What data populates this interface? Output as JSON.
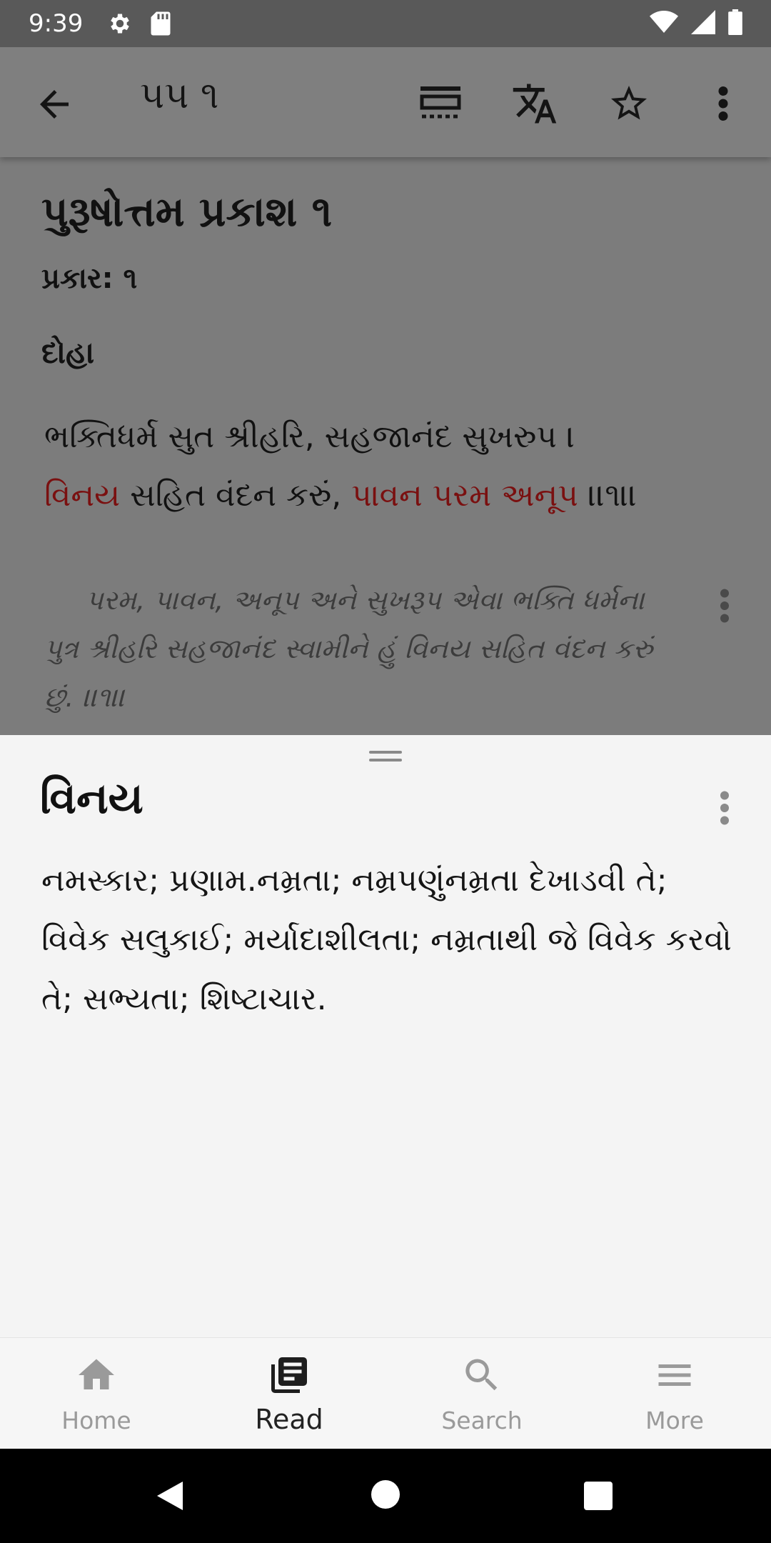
{
  "status_bar": {
    "time": "9:39",
    "icons": [
      "settings-icon",
      "sd-card-icon",
      "wifi-icon",
      "signal-icon",
      "battery-icon"
    ]
  },
  "app_bar": {
    "title": "૫૫ ૧",
    "actions": [
      "back-arrow-icon",
      "reading-mode-icon",
      "translate-icon",
      "star-icon",
      "more-vert-icon"
    ]
  },
  "content": {
    "heading": "પુરૂષોત્તમ પ્રકાશ ૧",
    "subheading": "પ્રકાર: ૧",
    "section": "દોહા",
    "verse_line1": "ભક્તિધર્મ સુત શ્રીહરિ, સહજાનંદ સુખરુપ ।",
    "verse_line2": {
      "hl1": "વિનય",
      "mid": " સહિત વંદન કરું, ",
      "hl2": "પાવન પરમ અનૂપ",
      "end": " ।।૧।।"
    },
    "meaning": "પરમ, પાવન, અનૂપ અને સુખરૂપ એવા ભક્તિ ધર્મના પુત્ર શ્રીહરિ સહજાનંદ સ્વામીને હું વિનય સહિત વંદન કરું છું. ।।૧।।"
  },
  "sheet": {
    "word": "વિનય",
    "definition": "નમસ્કાર; પ્રણામ.નમ્રતા; નમ્રપણુંનમ્રતા દેખાડવી તે; વિવેક સલુકાઈ; મર્યાદાશીલતા; નમ્રતાથી જે વિવેક કરવો તે; સભ્યતા; શિષ્ટાચાર."
  },
  "bottom_nav": {
    "items": [
      {
        "label": "Home",
        "icon": "home-icon"
      },
      {
        "label": "Read",
        "icon": "book-icon",
        "active": true
      },
      {
        "label": "Search",
        "icon": "search-icon"
      },
      {
        "label": "More",
        "icon": "menu-icon"
      }
    ]
  },
  "colors": {
    "highlight": "#7a1010",
    "scrim": "#7c7c7c",
    "sheet_bg": "#f4f4f4"
  }
}
